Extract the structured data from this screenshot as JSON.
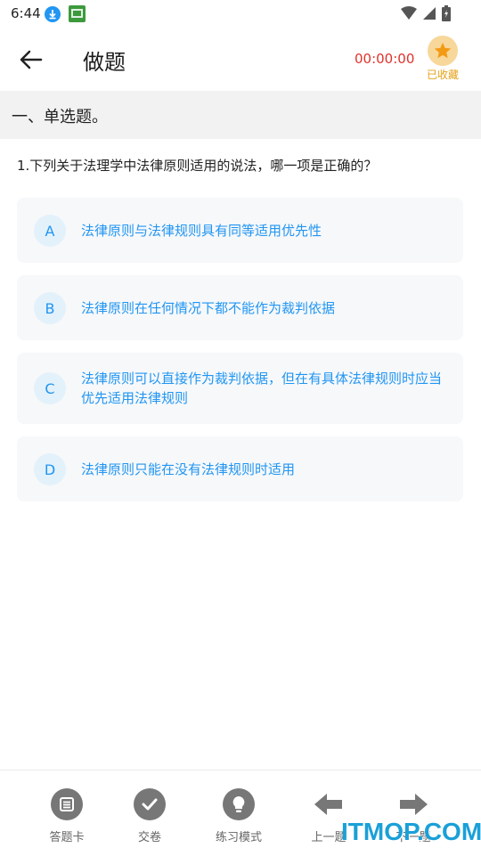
{
  "status_bar": {
    "time": "6:44"
  },
  "header": {
    "title": "做题",
    "timer": "00:00:00",
    "favorite_label": "已收藏"
  },
  "section": {
    "title": "一、单选题。"
  },
  "question": {
    "text": "1.下列关于法理学中法律原则适用的说法，哪一项是正确的？",
    "options": [
      {
        "letter": "A",
        "text": "法律原则与法律规则具有同等适用优先性"
      },
      {
        "letter": "B",
        "text": "法律原则在任何情况下都不能作为裁判依据"
      },
      {
        "letter": "C",
        "text": "法律原则可以直接作为裁判依据，但在有具体法律规则时应当优先适用法律规则"
      },
      {
        "letter": "D",
        "text": "法律原则只能在没有法律规则时适用"
      }
    ]
  },
  "bottom_nav": {
    "answer_card": "答题卡",
    "submit": "交卷",
    "practice_mode": "练习模式",
    "prev": "上一题",
    "next": "下一题"
  },
  "watermark": "ITMOP.COM",
  "colors": {
    "accent": "#2196f3",
    "timer": "#e0322c",
    "favorite": "#e6a118",
    "favorite_bg": "#f7d79a",
    "icon_gray": "#777777"
  }
}
